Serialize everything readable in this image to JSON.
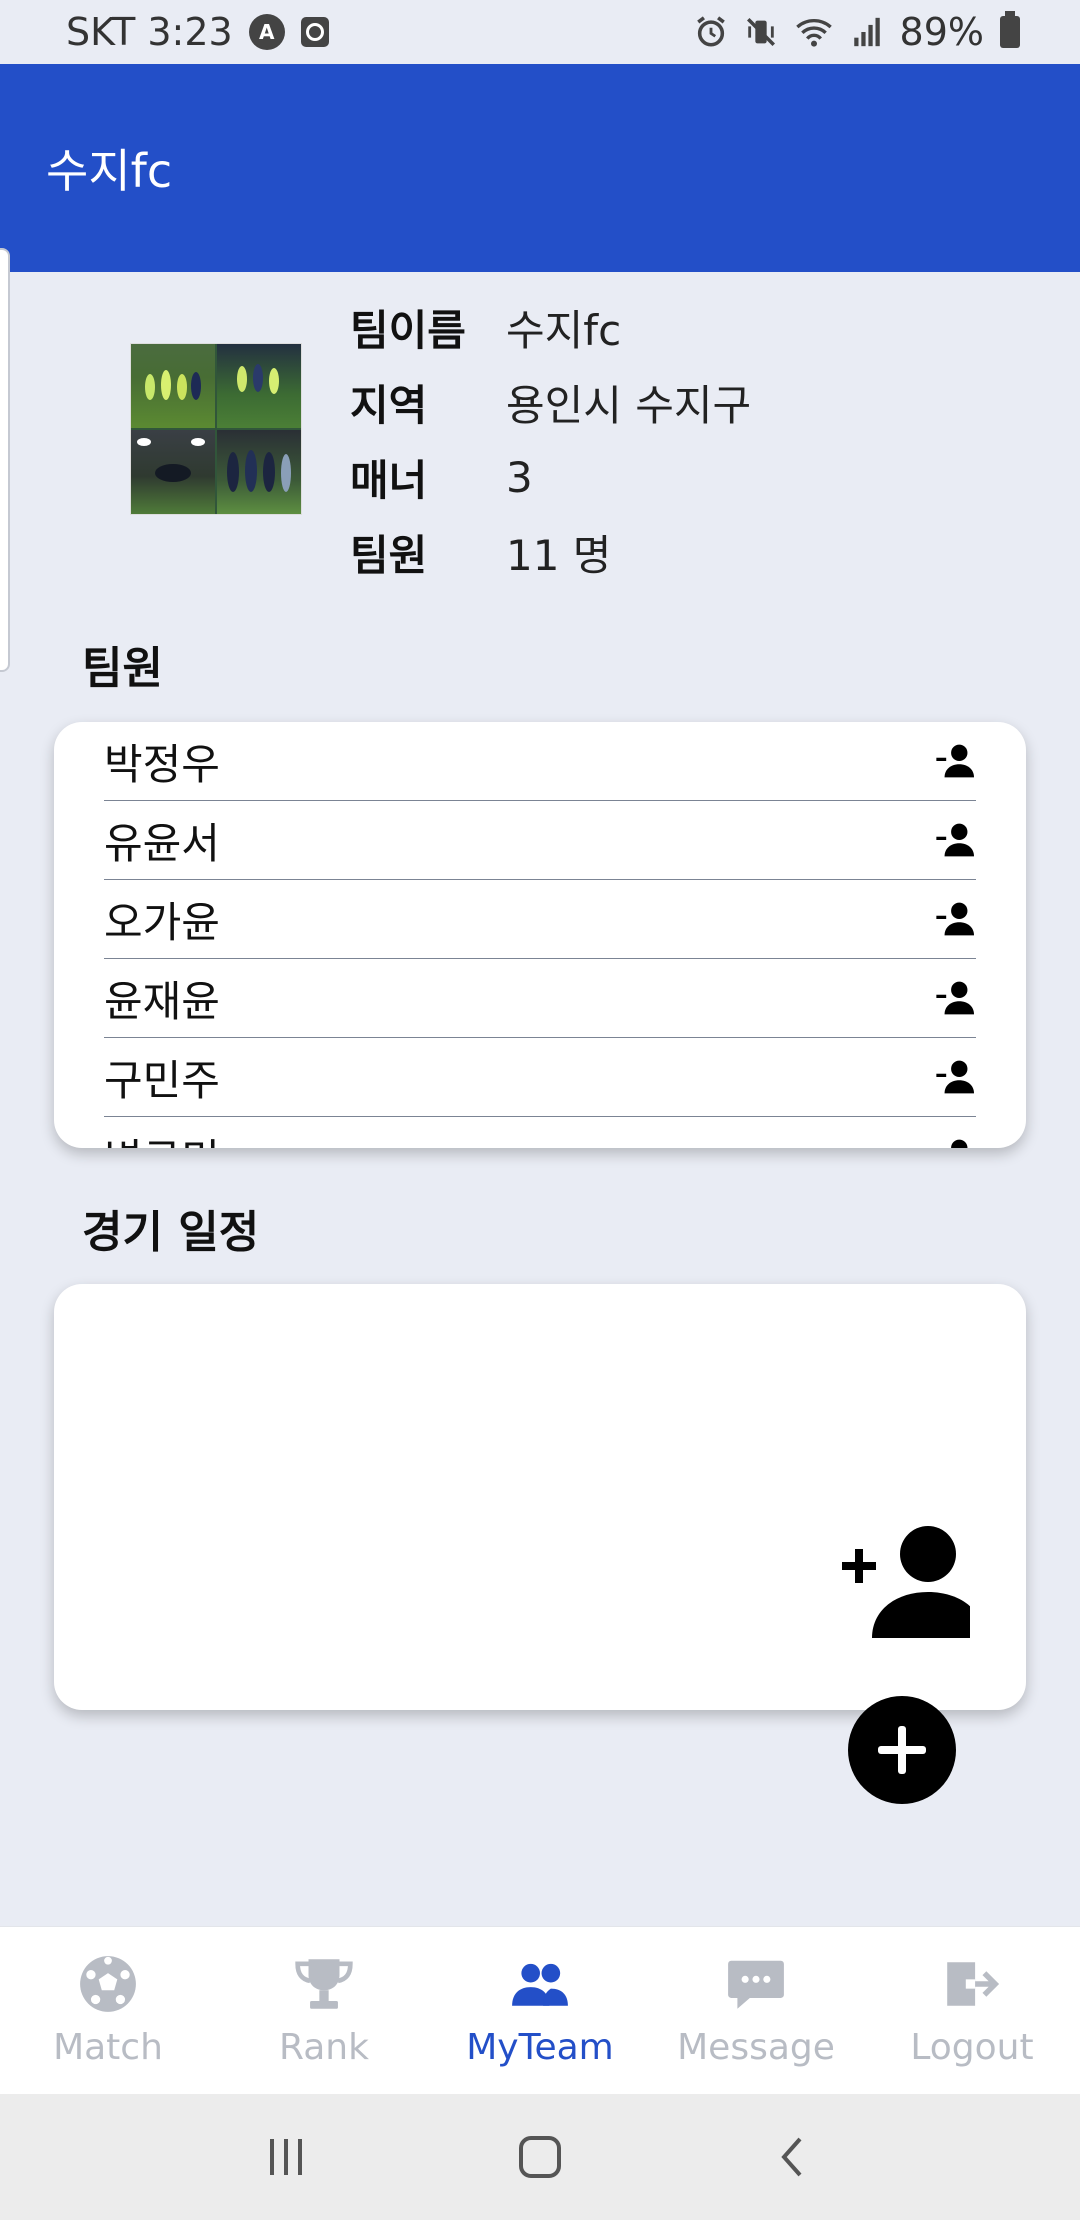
{
  "status_bar": {
    "carrier_time": "SKT 3:23",
    "battery": "89%",
    "badge_icon": "A"
  },
  "app_bar": {
    "title": "수지fc"
  },
  "team_info": {
    "rows": [
      {
        "key": "팀이름",
        "value": "수지fc"
      },
      {
        "key": "지역",
        "value": "용인시 수지구"
      },
      {
        "key": "매너",
        "value": "3"
      },
      {
        "key": "팀원",
        "value": "11 명"
      }
    ]
  },
  "members_section": {
    "title": "팀원",
    "members": [
      "박정우",
      "유윤서",
      "오가윤",
      "윤재윤",
      "구민주",
      "변규민"
    ]
  },
  "schedule_section": {
    "title": "경기 일정"
  },
  "bottom_nav": {
    "items": [
      {
        "label": "Match",
        "icon": "soccer-ball-icon"
      },
      {
        "label": "Rank",
        "icon": "trophy-icon"
      },
      {
        "label": "MyTeam",
        "icon": "team-icon"
      },
      {
        "label": "Message",
        "icon": "message-icon"
      },
      {
        "label": "Logout",
        "icon": "logout-icon"
      }
    ],
    "active": "MyTeam"
  },
  "colors": {
    "primary": "#234fc8",
    "background": "#e9ecf4",
    "inactive": "#b8bcc4"
  }
}
